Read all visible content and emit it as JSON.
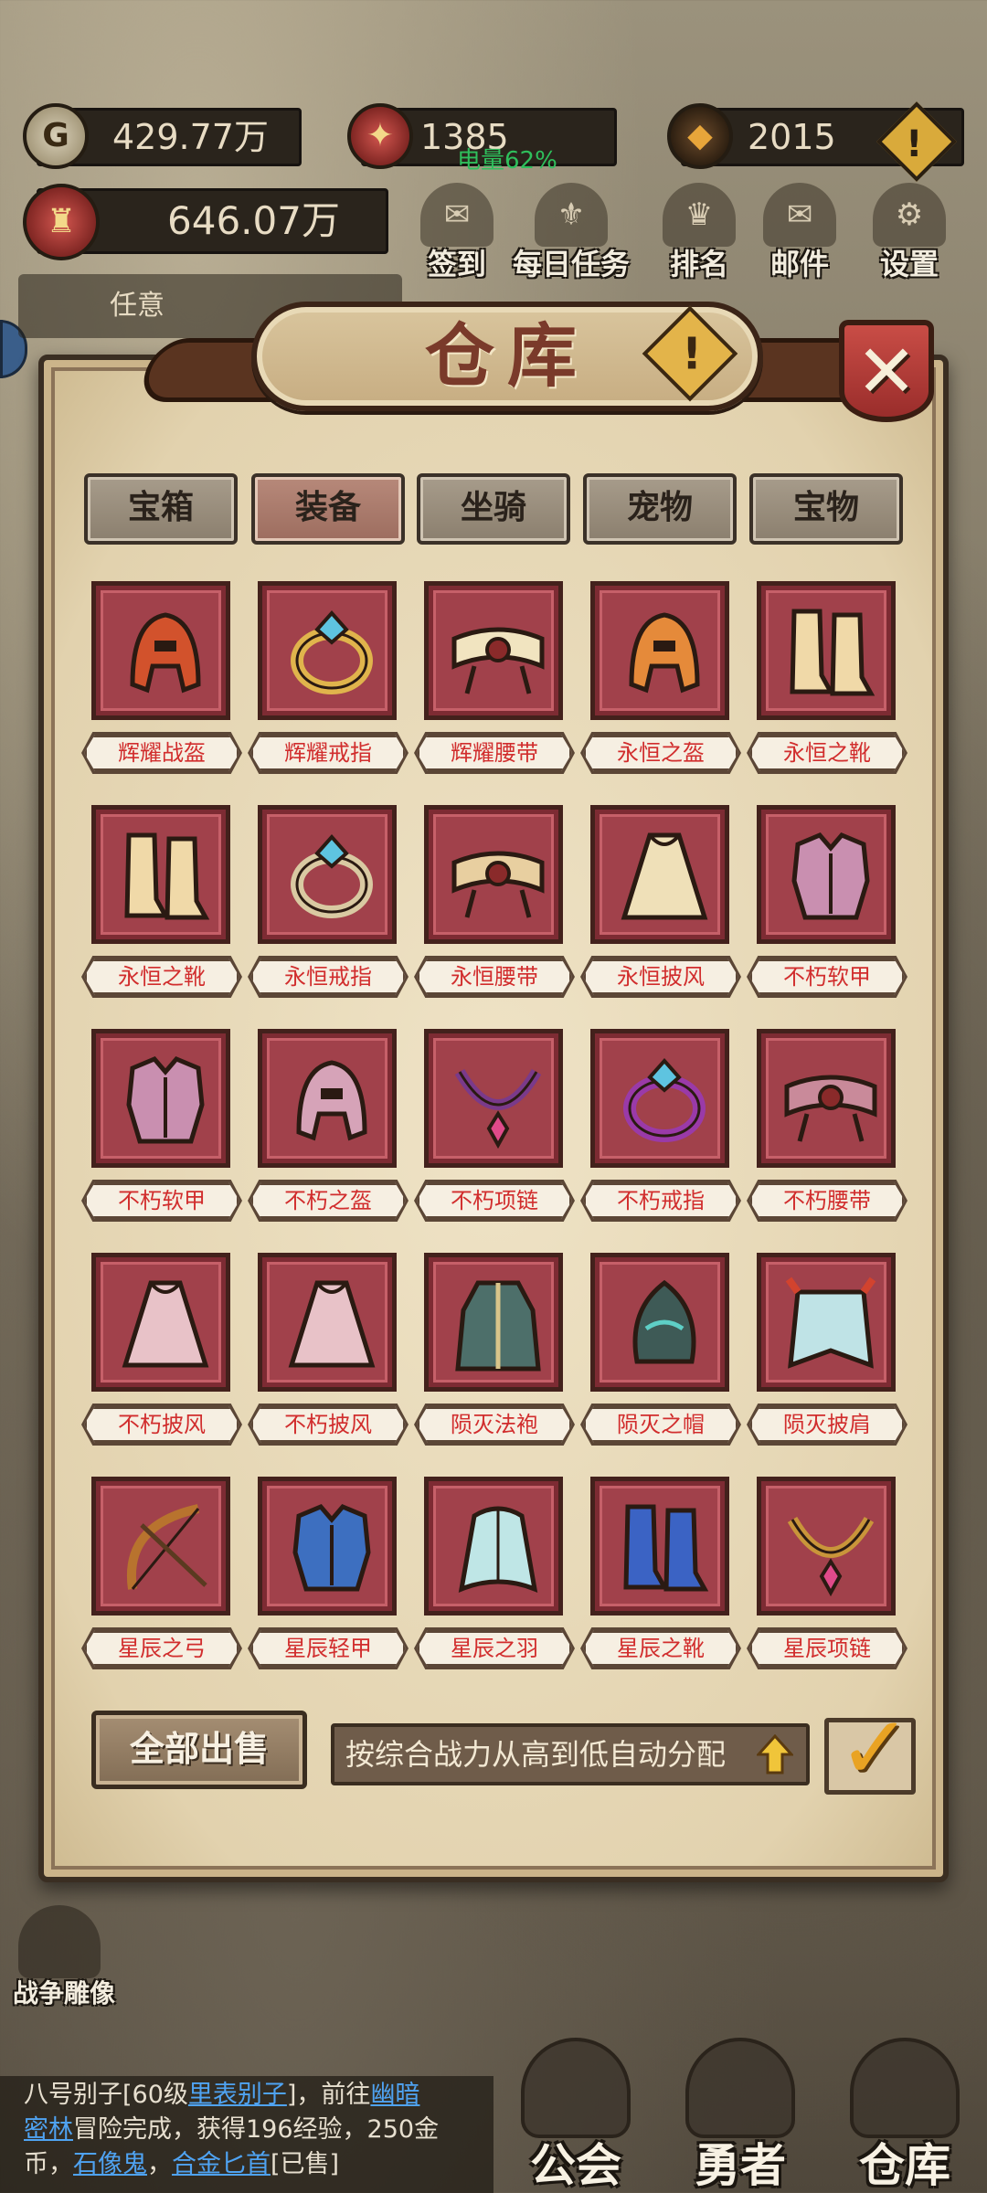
{
  "resources": {
    "gold": "429.77万",
    "honor": "1385",
    "gems": "2015",
    "power": "646.07万",
    "battery": "电量62%"
  },
  "top_menu": [
    {
      "label": "签到",
      "icon": "scroll-icon"
    },
    {
      "label": "每日任务",
      "icon": "quest-icon"
    },
    {
      "label": "排名",
      "icon": "crown-icon"
    },
    {
      "label": "邮件",
      "icon": "mail-icon"
    },
    {
      "label": "设置",
      "icon": "gear-icon"
    }
  ],
  "quest_hint": "任意",
  "warehouse": {
    "title": "仓库",
    "tabs": [
      {
        "label": "宝箱",
        "active": false
      },
      {
        "label": "装备",
        "active": true
      },
      {
        "label": "坐骑",
        "active": false
      },
      {
        "label": "宠物",
        "active": false
      },
      {
        "label": "宝物",
        "active": false
      }
    ],
    "items": [
      {
        "name": "辉耀战盔",
        "icon": "helmet-icon",
        "color": "#d2522c"
      },
      {
        "name": "辉耀戒指",
        "icon": "ring-icon",
        "color": "#e0b44c"
      },
      {
        "name": "辉耀腰带",
        "icon": "belt-icon",
        "color": "#f1e4c0"
      },
      {
        "name": "永恒之盔",
        "icon": "helmet-icon",
        "color": "#e58a3a"
      },
      {
        "name": "永恒之靴",
        "icon": "boots-icon",
        "color": "#f0d9a8"
      },
      {
        "name": "永恒之靴",
        "icon": "boots-icon",
        "color": "#f0d9a8"
      },
      {
        "name": "永恒戒指",
        "icon": "ring-icon",
        "color": "#d9c9a2"
      },
      {
        "name": "永恒腰带",
        "icon": "belt-icon",
        "color": "#e8cfa0"
      },
      {
        "name": "永恒披风",
        "icon": "cloak-icon",
        "color": "#efe0b8"
      },
      {
        "name": "不朽软甲",
        "icon": "armor-icon",
        "color": "#c98fb0"
      },
      {
        "name": "不朽软甲",
        "icon": "armor-icon",
        "color": "#c98fb0"
      },
      {
        "name": "不朽之盔",
        "icon": "helmet-icon",
        "color": "#d6a3b8"
      },
      {
        "name": "不朽项链",
        "icon": "necklace-icon",
        "color": "#7a3a8a"
      },
      {
        "name": "不朽戒指",
        "icon": "ring-icon",
        "color": "#9a3aa8"
      },
      {
        "name": "不朽腰带",
        "icon": "belt-icon",
        "color": "#c98a9a"
      },
      {
        "name": "不朽披风",
        "icon": "cloak-icon",
        "color": "#e8c2c8"
      },
      {
        "name": "不朽披风",
        "icon": "cloak-icon",
        "color": "#e8c2c8"
      },
      {
        "name": "陨灭法袍",
        "icon": "robe-icon",
        "color": "#4d6f6a"
      },
      {
        "name": "陨灭之帽",
        "icon": "hat-icon",
        "color": "#3e5a56"
      },
      {
        "name": "陨灭披肩",
        "icon": "cape-icon",
        "color": "#bfe3e6"
      },
      {
        "name": "星辰之弓",
        "icon": "bow-icon",
        "color": "#b8732e"
      },
      {
        "name": "星辰轻甲",
        "icon": "armor-icon",
        "color": "#3d6fc0"
      },
      {
        "name": "星辰之羽",
        "icon": "feather-icon",
        "color": "#bfe6e6"
      },
      {
        "name": "星辰之靴",
        "icon": "boots-icon",
        "color": "#3b63c4"
      },
      {
        "name": "星辰项链",
        "icon": "necklace-icon",
        "color": "#c9953a"
      }
    ],
    "sell_all": "全部出售",
    "auto_assign": "按综合战力从高到低自动分配",
    "auto_checked": true
  },
  "war_statue": "战争雕像",
  "log": {
    "line1": "八号别子[60级",
    "line1b": "里表别子",
    "line1c": "]，前往",
    "line1d": "幽暗",
    "line2a": "密林",
    "line2b": "冒险完成，获得196经验，250金",
    "line3a": "币，",
    "line3b": "石像鬼",
    "line3c": "，",
    "line3d": "合金匕首",
    "line3e": "[已售]"
  },
  "bottom_nav": [
    {
      "label": "公会",
      "icon": "guild-icon"
    },
    {
      "label": "勇者",
      "icon": "hero-icon"
    },
    {
      "label": "仓库",
      "icon": "warehouse-icon"
    }
  ]
}
